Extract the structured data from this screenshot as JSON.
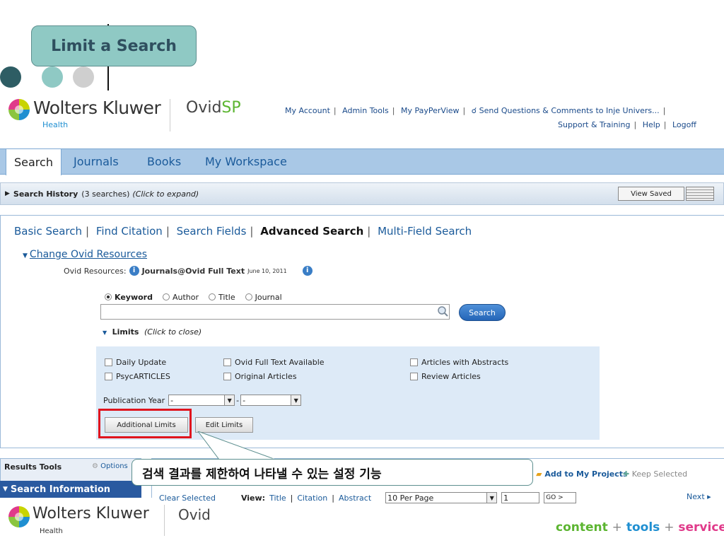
{
  "slide": {
    "title": "Limit a Search",
    "callout": "검색 결과를 제한하여 나타낼 수 있는 설정 기능"
  },
  "header": {
    "brand": "Wolters Kluwer",
    "brand_sub": "Health",
    "product_a": "Ovid",
    "product_b": "SP",
    "links": [
      "My Account",
      "Admin Tools",
      "My PayPerView",
      "Send Questions & Comments to Inje Univers..."
    ],
    "links2": [
      "Support & Training",
      "Help",
      "Logoff"
    ]
  },
  "tabs": [
    "Search",
    "Journals",
    "Books",
    "My Workspace"
  ],
  "history": {
    "label": "Search History",
    "count": "(3 searches)",
    "hint": "(Click to expand)",
    "view_saved": "View Saved"
  },
  "search_modes": {
    "basic": "Basic Search",
    "citation": "Find Citation",
    "fields": "Search Fields",
    "advanced": "Advanced Search",
    "multi": "Multi-Field Search"
  },
  "resources": {
    "change": "Change Ovid Resources",
    "label": "Ovid Resources:",
    "name": "Journals@Ovid Full Text",
    "date": "June 10, 2011"
  },
  "radios": [
    "Keyword",
    "Author",
    "Title",
    "Journal"
  ],
  "search": {
    "value": "",
    "button": "Search"
  },
  "limits": {
    "title": "Limits",
    "hint": "(Click to close)",
    "checkboxes": [
      "Daily Update",
      "Ovid Full Text Available",
      "Articles with Abstracts",
      "PsycARTICLES",
      "Original Articles",
      "Review Articles"
    ],
    "pub_year_label": "Publication Year",
    "from": "-",
    "to": "-",
    "additional": "Additional Limits",
    "edit": "Edit Limits"
  },
  "results": {
    "tools": "Results Tools",
    "options": "Options",
    "info": "Search Information",
    "clear": "Clear Selected",
    "view": "View:",
    "views": [
      "Title",
      "Citation",
      "Abstract"
    ],
    "per_page": "10 Per Page",
    "page_no": "1",
    "go": "GO >",
    "add_projects": "Add to My Projects",
    "keep": "Keep Selected",
    "next": "Next ▸"
  },
  "footer": {
    "brand": "Wolters Kluwer",
    "sub": "Health",
    "product": "Ovid",
    "tag1": "content",
    "tag2": "tools",
    "tag3": "services",
    "plus": "+"
  }
}
